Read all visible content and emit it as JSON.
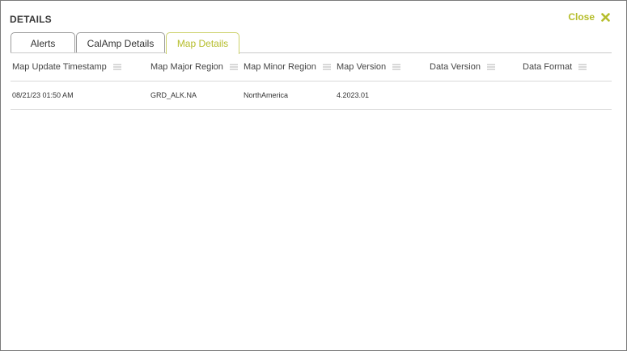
{
  "header": {
    "title": "DETAILS",
    "close_label": "Close"
  },
  "tabs": [
    {
      "label": "Alerts",
      "active": false
    },
    {
      "label": "CalAmp Details",
      "active": false
    },
    {
      "label": "Map Details",
      "active": true
    }
  ],
  "table": {
    "columns": [
      "Map Update Timestamp",
      "Map Major Region",
      "Map Minor Region",
      "Map Version",
      "Data Version",
      "Data Format"
    ],
    "rows": [
      [
        "08/21/23 01:50 AM",
        "GRD_ALK.NA",
        "NorthAmerica",
        "4.2023.01",
        "",
        ""
      ]
    ]
  },
  "colors": {
    "accent": "#b5bd2a",
    "border": "#7a7a7a"
  },
  "icons": {
    "close": "x-icon",
    "column_menu": "column-menu-icon"
  }
}
